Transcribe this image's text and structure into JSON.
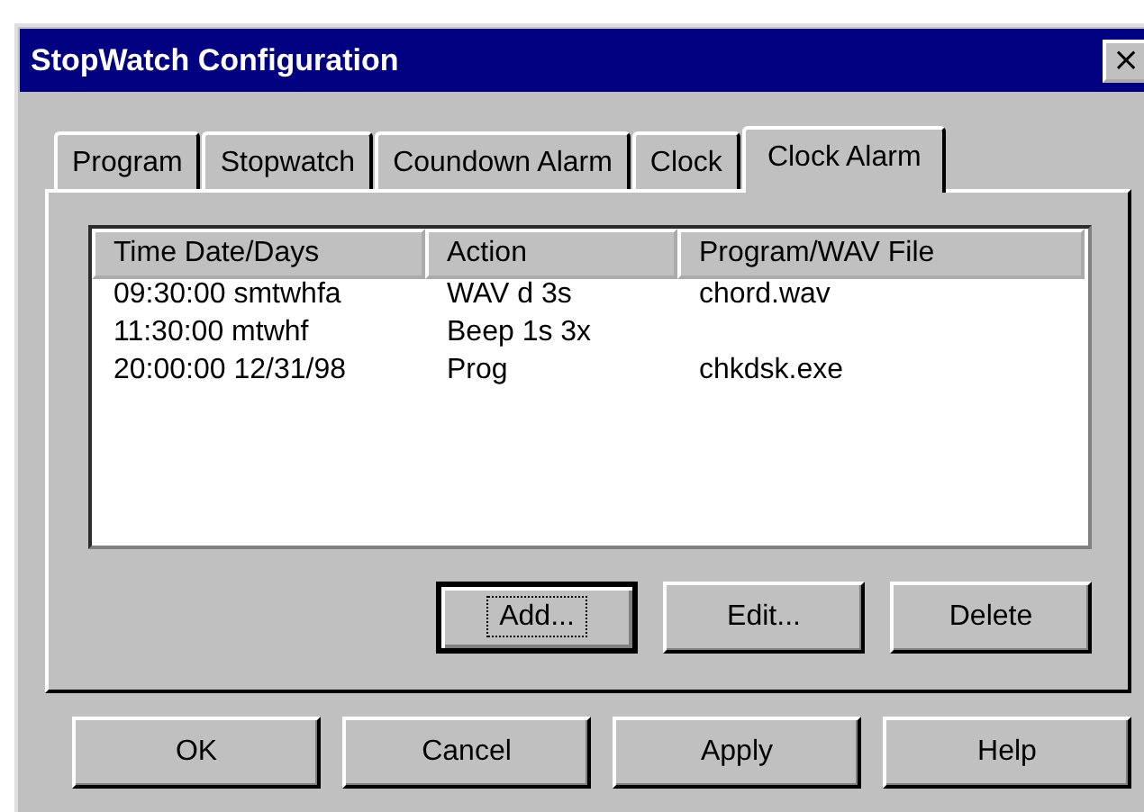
{
  "window": {
    "title": "StopWatch Configuration",
    "close": "×"
  },
  "tabs": [
    {
      "label": "Program",
      "selected": false
    },
    {
      "label": "Stopwatch",
      "selected": false
    },
    {
      "label": "Coundown Alarm",
      "selected": false
    },
    {
      "label": "Clock",
      "selected": false
    },
    {
      "label": "Clock Alarm",
      "selected": true
    }
  ],
  "table": {
    "columns": [
      "Time Date/Days",
      "Action",
      "Program/WAV File"
    ],
    "rows": [
      [
        "09:30:00 smtwhfa",
        "WAV d 3s",
        "chord.wav"
      ],
      [
        "11:30:00 mtwhf",
        "Beep 1s 3x",
        ""
      ],
      [
        "20:00:00 12/31/98",
        "Prog",
        "chkdsk.exe"
      ]
    ]
  },
  "list_buttons": [
    {
      "label": "Add...",
      "focused": true
    },
    {
      "label": "Edit...",
      "focused": false
    },
    {
      "label": "Delete",
      "focused": false
    }
  ],
  "dialog_buttons": [
    {
      "label": "OK"
    },
    {
      "label": "Cancel"
    },
    {
      "label": "Apply"
    },
    {
      "label": "Help"
    }
  ]
}
